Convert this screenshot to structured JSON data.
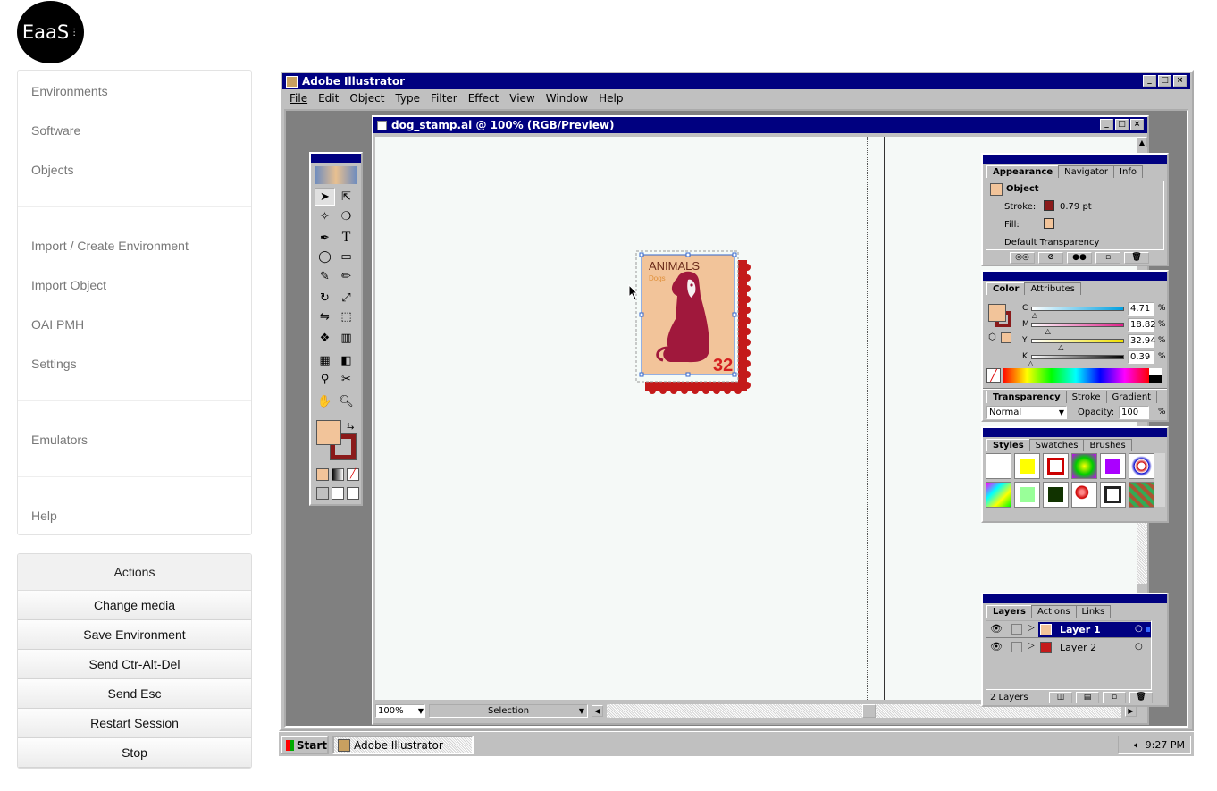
{
  "logo": {
    "text": "EaaS"
  },
  "nav": {
    "items": [
      "Environments",
      "Software",
      "Objects",
      "Import / Create Environment",
      "Import Object",
      "OAI PMH",
      "Settings",
      "Emulators",
      "Help"
    ]
  },
  "actions": {
    "title": "Actions",
    "buttons": [
      "Change media",
      "Save Environment",
      "Send Ctr-Alt-Del",
      "Send Esc",
      "Restart Session",
      "Stop"
    ]
  },
  "app": {
    "title": "Adobe Illustrator",
    "menu": [
      "File",
      "Edit",
      "Object",
      "Type",
      "Filter",
      "Effect",
      "View",
      "Window",
      "Help"
    ],
    "document_title": "dog_stamp.ai @ 100% (RGB/Preview)",
    "zoom": "100%",
    "status_mode": "Selection"
  },
  "stamp": {
    "title": "ANIMALS",
    "subtitle": "Dogs",
    "value": "32"
  },
  "appearance": {
    "tabs": [
      "Appearance",
      "Navigator",
      "Info"
    ],
    "object_label": "Object",
    "stroke_label": "Stroke:",
    "stroke_value": "0.79 pt",
    "fill_label": "Fill:",
    "transparency_label": "Default Transparency"
  },
  "color": {
    "tabs": [
      "Color",
      "Attributes"
    ],
    "channels": [
      {
        "label": "C",
        "value": "4.71",
        "pct": 4.71
      },
      {
        "label": "M",
        "value": "18.82",
        "pct": 18.82
      },
      {
        "label": "Y",
        "value": "32.94",
        "pct": 32.94
      },
      {
        "label": "K",
        "value": "0.39",
        "pct": 0.39
      }
    ],
    "unit": "%"
  },
  "transparency": {
    "tabs": [
      "Transparency",
      "Stroke",
      "Gradient"
    ],
    "mode": "Normal",
    "opacity_label": "Opacity:",
    "opacity": "100",
    "unit": "%"
  },
  "styles": {
    "tabs": [
      "Styles",
      "Swatches",
      "Brushes"
    ]
  },
  "layers": {
    "tabs": [
      "Layers",
      "Actions",
      "Links"
    ],
    "items": [
      "Layer 1",
      "Layer 2"
    ],
    "count": "2 Layers"
  },
  "taskbar": {
    "start": "Start",
    "task": "Adobe Illustrator",
    "time": "9:27 PM"
  },
  "colors": {
    "fill": "#f2c49a",
    "stroke": "#8a1a1a",
    "dog": "#a0183c",
    "titlebar": "#000080"
  }
}
